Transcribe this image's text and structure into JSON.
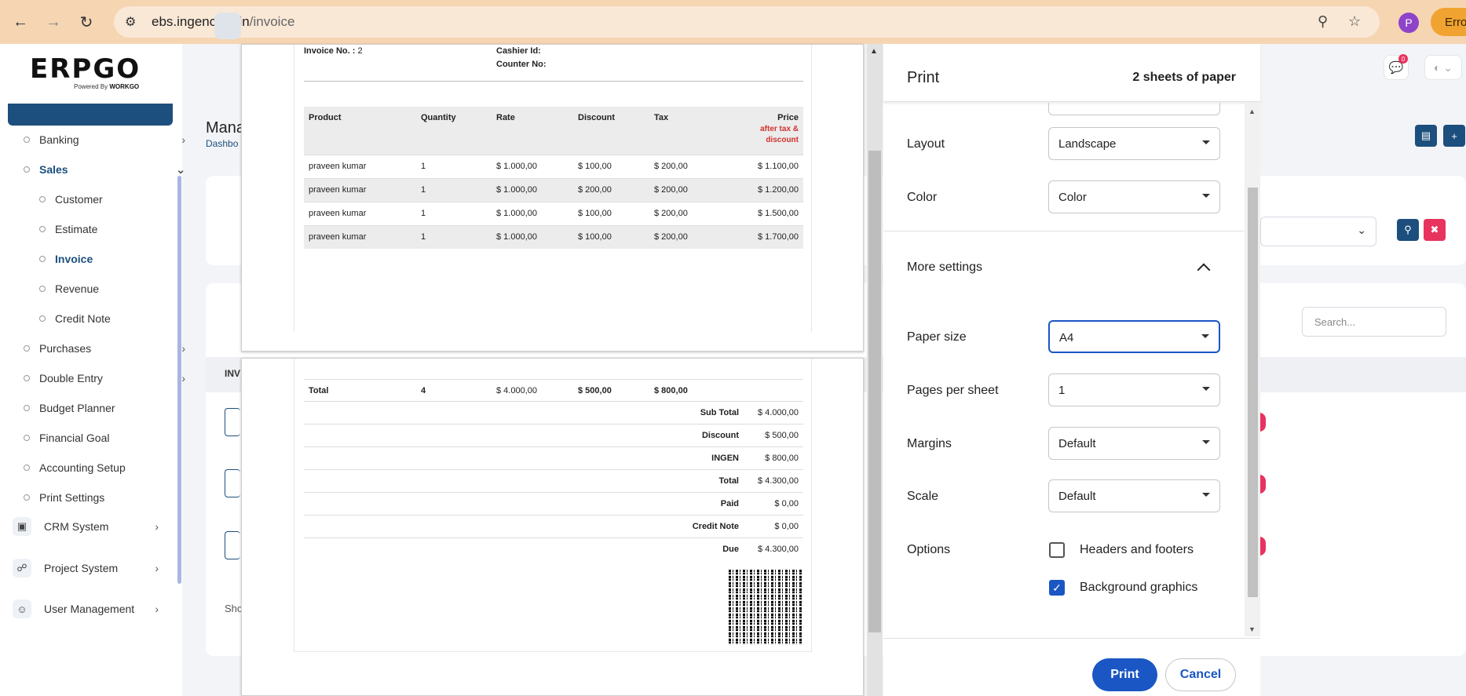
{
  "browser": {
    "url_domain": "ebs.ingencorp.in",
    "url_path": "/invoice",
    "profile_initial": "P",
    "error_label": "Error"
  },
  "sidebar": {
    "logo_text": "ERPGO",
    "logo_tagline": "Powered By",
    "logo_brand": "WORKGO",
    "items": [
      {
        "label": "Banking"
      },
      {
        "label": "Sales"
      },
      {
        "label": "Customer"
      },
      {
        "label": "Estimate"
      },
      {
        "label": "Invoice"
      },
      {
        "label": "Revenue"
      },
      {
        "label": "Credit Note"
      },
      {
        "label": "Purchases"
      },
      {
        "label": "Double Entry"
      },
      {
        "label": "Budget Planner"
      },
      {
        "label": "Financial Goal"
      },
      {
        "label": "Accounting Setup"
      },
      {
        "label": "Print Settings"
      },
      {
        "label": "CRM System"
      },
      {
        "label": "Project System"
      },
      {
        "label": "User Management"
      }
    ]
  },
  "main": {
    "title_fragment": "Mana",
    "crumb_fragment": "Dashbo",
    "table_header_fragment": "INV",
    "show_fragment": "Sho",
    "search_placeholder": "Search...",
    "notif_count": "0"
  },
  "invoice": {
    "invoice_no_label": "Invoice No. :",
    "invoice_no": "2",
    "cashier_label": "Cashier Id:",
    "counter_label": "Counter No:",
    "columns": [
      "Product",
      "Quantity",
      "Rate",
      "Discount",
      "Tax",
      "Price"
    ],
    "price_note_1": "after tax &",
    "price_note_2": "discount",
    "rows": [
      [
        "praveen kumar",
        "1",
        "$ 1.000,00",
        "$ 100,00",
        "$ 200,00",
        "$ 1.100,00"
      ],
      [
        "praveen kumar",
        "1",
        "$ 1.000,00",
        "$ 200,00",
        "$ 200,00",
        "$ 1.200,00"
      ],
      [
        "praveen kumar",
        "1",
        "$ 1.000,00",
        "$ 100,00",
        "$ 200,00",
        "$ 1.500,00"
      ],
      [
        "praveen kumar",
        "1",
        "$ 1.000,00",
        "$ 100,00",
        "$ 200,00",
        "$ 1.700,00"
      ]
    ],
    "total_row": {
      "label": "Total",
      "qty": "4",
      "rate": "$ 4.000,00",
      "discount": "$ 500,00",
      "tax": "$ 800,00"
    },
    "summary": [
      {
        "label": "Sub Total",
        "value": "$ 4.000,00"
      },
      {
        "label": "Discount",
        "value": "$ 500,00"
      },
      {
        "label": "INGEN",
        "value": "$ 800,00"
      },
      {
        "label": "Total",
        "value": "$ 4.300,00"
      },
      {
        "label": "Paid",
        "value": "$ 0,00"
      },
      {
        "label": "Credit Note",
        "value": "$ 0,00"
      },
      {
        "label": "Due",
        "value": "$ 4.300,00"
      }
    ]
  },
  "print_dialog": {
    "title": "Print",
    "sheets": "2 sheets of paper",
    "layout_label": "Layout",
    "layout_value": "Landscape",
    "color_label": "Color",
    "color_value": "Color",
    "more_settings": "More settings",
    "paper_size_label": "Paper size",
    "paper_size_value": "A4",
    "pages_per_sheet_label": "Pages per sheet",
    "pages_per_sheet_value": "1",
    "margins_label": "Margins",
    "margins_value": "Default",
    "scale_label": "Scale",
    "scale_value": "Default",
    "options_label": "Options",
    "headers_footers_label": "Headers and footers",
    "headers_footers_checked": false,
    "background_graphics_label": "Background graphics",
    "background_graphics_checked": true,
    "print_button": "Print",
    "cancel_button": "Cancel"
  },
  "colors": {
    "accent": "#1a56c4",
    "brand_navy": "#1c4f7d",
    "chrome_bg": "#f6d5b3",
    "danger": "#e8335f",
    "price_note": "#d0312d"
  }
}
